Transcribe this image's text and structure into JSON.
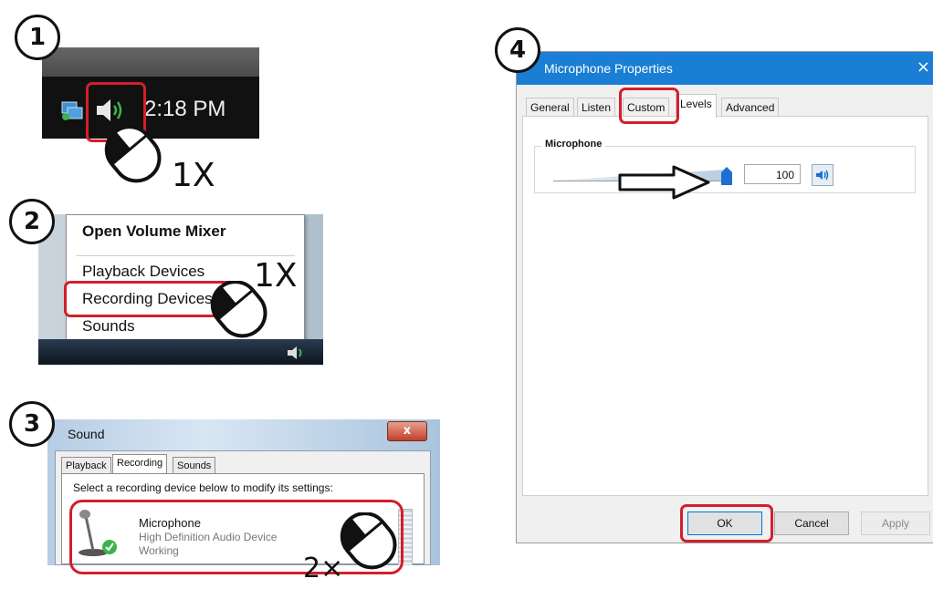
{
  "steps": {
    "one": "1",
    "two": "2",
    "three": "3",
    "four": "4"
  },
  "panel1": {
    "clock": "2:18 PM",
    "click_count": "1X"
  },
  "panel2": {
    "menu_items": [
      "Open Volume Mixer",
      "Playback Devices",
      "Recording Devices",
      "Sounds"
    ],
    "click_count": "1X"
  },
  "panel3": {
    "window_title": "Sound",
    "close_label": "x",
    "tabs": [
      "Playback",
      "Recording",
      "Sounds"
    ],
    "active_tab": "Recording",
    "instruction": "Select a recording device below to modify its settings:",
    "device": {
      "name": "Microphone",
      "driver": "High Definition Audio Device",
      "status": "Working"
    },
    "click_count": "2×"
  },
  "panel4": {
    "window_title": "Microphone Properties",
    "close_label": "×",
    "tabs": [
      "General",
      "Listen",
      "Custom",
      "Levels",
      "Advanced"
    ],
    "active_tab": "Levels",
    "group_label": "Microphone",
    "level_value": "100",
    "level_fraction": 1.0,
    "buttons": {
      "ok": "OK",
      "cancel": "Cancel",
      "apply": "Apply"
    }
  },
  "colors": {
    "highlight_red": "#d21f2b",
    "title_blue": "#1a7fd4",
    "tray_green": "#39b54a"
  },
  "icons": [
    "speaker-icon",
    "network-icon",
    "mouse-icon",
    "microphone-icon",
    "check-icon",
    "arrow-icon"
  ]
}
